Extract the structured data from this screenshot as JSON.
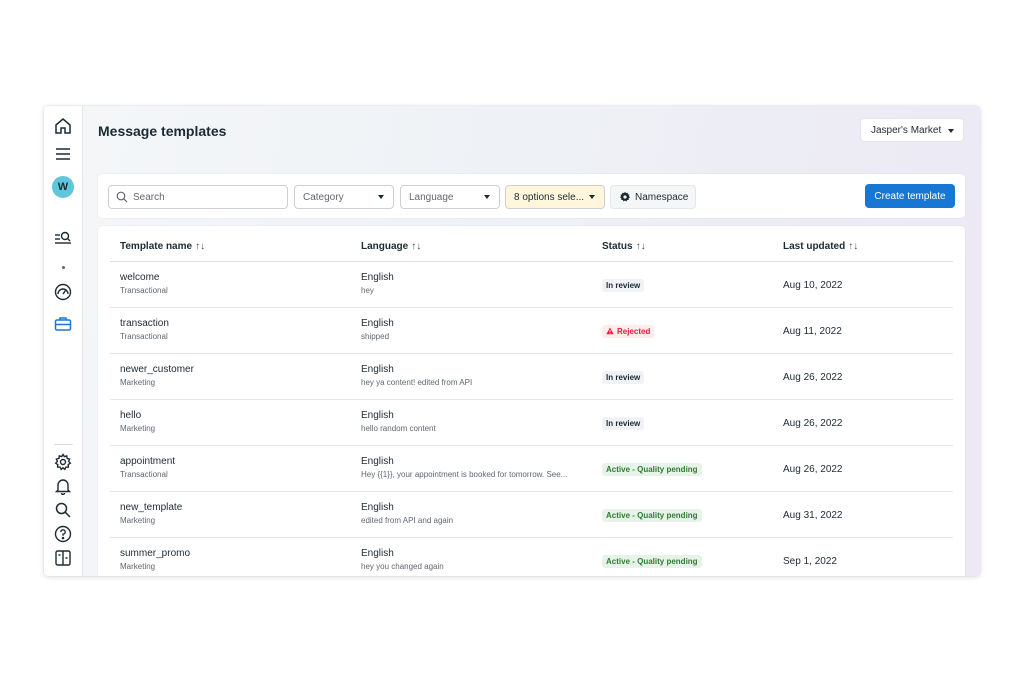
{
  "page_title": "Message templates",
  "account_selector": {
    "value": "Jasper's Market"
  },
  "avatar_letter": "W",
  "toolbar": {
    "search_placeholder": "Search",
    "category_label": "Category",
    "language_label": "Language",
    "status_filter_label": "8 options sele...",
    "namespace_label": "Namespace",
    "create_label": "Create template"
  },
  "table": {
    "headers": {
      "name": "Template name",
      "language": "Language",
      "status": "Status",
      "updated": "Last updated",
      "sort_glyph": "↑↓"
    },
    "rows": [
      {
        "name": "welcome",
        "category": "Transactional",
        "language": "English",
        "content": "hey",
        "status": "In review",
        "status_type": "review",
        "updated": "Aug 10, 2022"
      },
      {
        "name": "transaction",
        "category": "Transactional",
        "language": "English",
        "content": "shipped",
        "status": "Rejected",
        "status_type": "rejected",
        "updated": "Aug 11, 2022"
      },
      {
        "name": "newer_customer",
        "category": "Marketing",
        "language": "English",
        "content": "hey ya content! edited from API",
        "status": "In review",
        "status_type": "review",
        "updated": "Aug 26, 2022"
      },
      {
        "name": "hello",
        "category": "Marketing",
        "language": "English",
        "content": "hello random content",
        "status": "In review",
        "status_type": "review",
        "updated": "Aug 26, 2022"
      },
      {
        "name": "appointment",
        "category": "Transactional",
        "language": "English",
        "content": "Hey {{1}}, your appointment is booked for tomorrow. See...",
        "status": "Active - Quality pending",
        "status_type": "active",
        "updated": "Aug 26, 2022"
      },
      {
        "name": "new_template",
        "category": "Marketing",
        "language": "English",
        "content": "edited from API and again",
        "status": "Active - Quality pending",
        "status_type": "active",
        "updated": "Aug 31, 2022"
      },
      {
        "name": "summer_promo",
        "category": "Marketing",
        "language": "English",
        "content": "hey you changed again",
        "status": "Active - Quality pending",
        "status_type": "active",
        "updated": "Sep 1, 2022"
      }
    ]
  },
  "sidebar_icons": [
    "home-icon",
    "menu-icon",
    "avatar",
    "search-list-icon",
    "dot",
    "dashboard-gauge-icon",
    "briefcase-icon",
    "settings-gear-icon",
    "bell-icon",
    "search-icon",
    "help-icon",
    "panel-toggle-icon"
  ],
  "colors": {
    "primary_button": "#1877d2",
    "active_sidebar_icon": "#1877d2",
    "rejected": "#e41e3f",
    "active_status": "#2e7d32",
    "filter_highlight": "#fff6db"
  }
}
